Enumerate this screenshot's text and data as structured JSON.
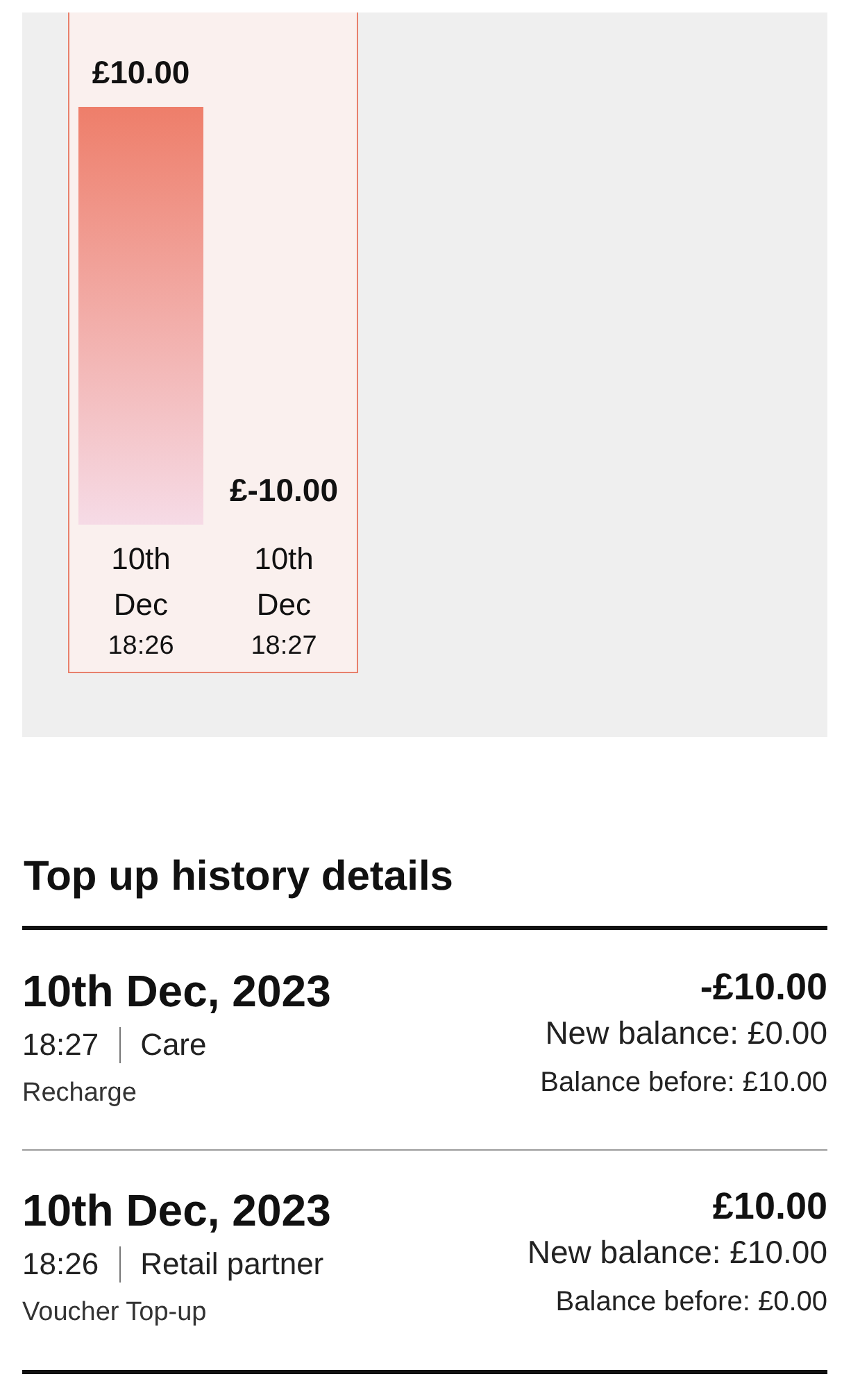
{
  "chart": {
    "chart_data": {
      "type": "bar",
      "categories": [
        "10th Dec 18:26",
        "10th Dec 18:27"
      ],
      "values": [
        10,
        null
      ],
      "value_labels": [
        "£10.00",
        "£-10.00"
      ],
      "ylim": [
        0,
        10
      ]
    }
  },
  "history": {
    "title": "Top up history details",
    "items": [
      {
        "date": "10th Dec, 2023",
        "time": "18:27",
        "source": "Care",
        "type": "Recharge",
        "amount": "-£10.00",
        "new_balance": "New balance: £0.00",
        "balance_before": "Balance before: £10.00"
      },
      {
        "date": "10th Dec, 2023",
        "time": "18:26",
        "source": "Retail partner",
        "type": "Voucher Top-up",
        "amount": "£10.00",
        "new_balance": "New balance: £10.00",
        "balance_before": "Balance before: £0.00"
      }
    ]
  }
}
